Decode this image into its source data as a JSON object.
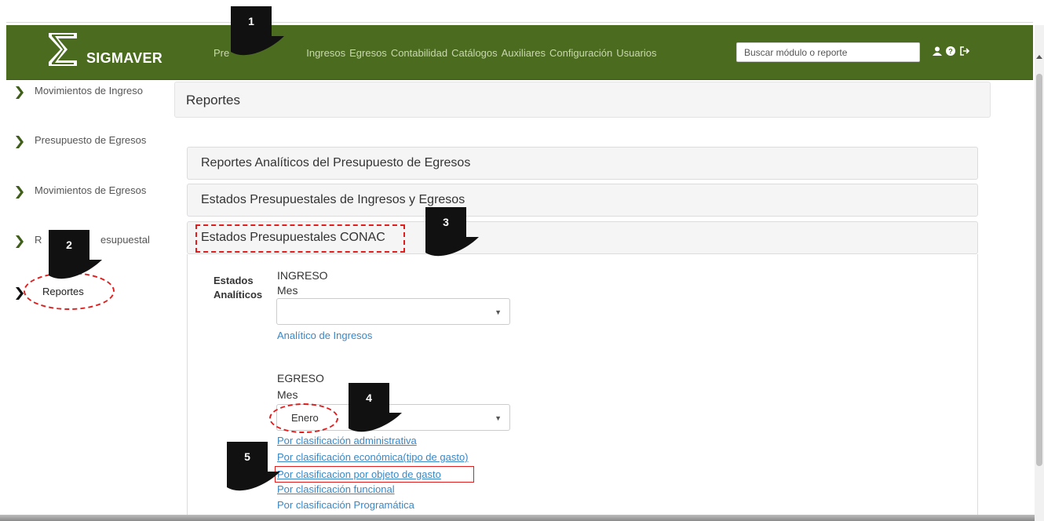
{
  "app": {
    "brand": "SIGMAVER",
    "accent": "#4b6b1f",
    "link_color": "#3a87c7",
    "annotation_color": "#e01e1e"
  },
  "nav": {
    "items": [
      "Pre",
      "Ingresos",
      "Egresos",
      "Contabilidad",
      "Catálogos",
      "Auxiliares",
      "Configuración",
      "Usuarios"
    ],
    "search_placeholder": "Buscar módulo o reporte",
    "icons": [
      "user-icon",
      "help-icon",
      "logout-icon"
    ]
  },
  "sidebar": {
    "items": [
      {
        "label": "Movimientos de Ingreso"
      },
      {
        "label": "Presupuesto de Egresos"
      },
      {
        "label": "Movimientos de Egresos"
      },
      {
        "label_left": "R",
        "label_right": "esupuestal"
      },
      {
        "label": "Reportes"
      }
    ]
  },
  "page": {
    "title": "Reportes"
  },
  "accordion": {
    "sections": [
      {
        "label": "Reportes Analíticos del Presupuesto de Egresos"
      },
      {
        "label": "Estados Presupuestales de Ingresos y Egresos"
      },
      {
        "label": "Estados Presupuestales CONAC"
      }
    ]
  },
  "conac": {
    "group_label_1": "Estados",
    "group_label_2": "Analíticos",
    "ingreso": {
      "heading": "INGRESO",
      "mes_label": "Mes",
      "selected": "",
      "link": "Analítico de Ingresos"
    },
    "egreso": {
      "heading": "EGRESO",
      "mes_label": "Mes",
      "selected": "Enero",
      "links": [
        "Por clasificación administrativa",
        "Por clasificación económica(tipo de gasto)",
        "Por clasificacion por objeto de gasto",
        "Por clasificación funcional",
        "Por clasificación Programática"
      ]
    }
  },
  "callouts": [
    "1",
    "2",
    "3",
    "4",
    "5"
  ]
}
